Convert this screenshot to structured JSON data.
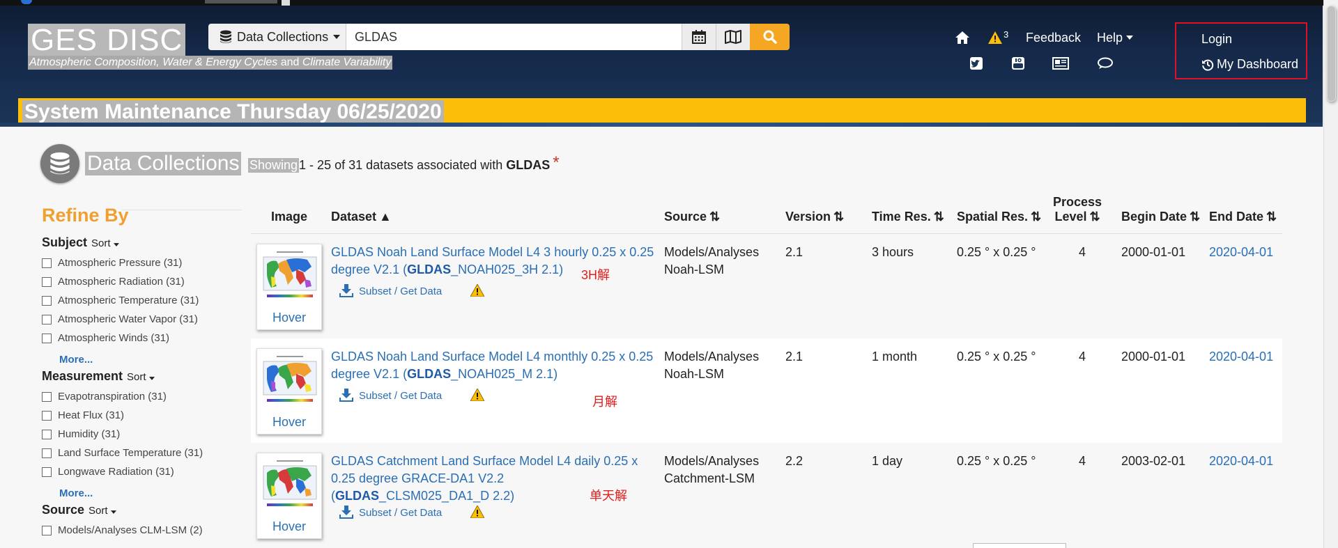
{
  "header": {
    "logo": "GES DISC",
    "tagline": {
      "part1": "Atmospheric Composition, Water & Energy Cycles ",
      "and": " and ",
      "part2": "Climate Variability"
    },
    "search": {
      "collections_label": "Data Collections",
      "query": "GLDAS"
    },
    "nav": {
      "alerts_count": "3",
      "feedback": "Feedback",
      "help": "Help"
    },
    "login": "Login",
    "dashboard": "My Dashboard"
  },
  "banner": {
    "text": "System Maintenance Thursday 06/25/2020"
  },
  "page": {
    "title": "Data Collections",
    "showing_hl": "Showing",
    "showing_rest": " 1 - 25 of 31 datasets associated with",
    "keyword": "GLDAS",
    "star": "*"
  },
  "sidebar": {
    "title": "Refine By",
    "sort_label": "Sort",
    "more_label": "More...",
    "subject": {
      "title": "Subject",
      "options": [
        "Atmospheric Pressure (31)",
        "Atmospheric Radiation (31)",
        "Atmospheric Temperature (31)",
        "Atmospheric Water Vapor (31)",
        "Atmospheric Winds (31)"
      ]
    },
    "measurement": {
      "title": "Measurement",
      "options": [
        "Evapotranspiration (31)",
        "Heat Flux (31)",
        "Humidity (31)",
        "Land Surface Temperature (31)",
        "Longwave Radiation (31)"
      ]
    },
    "source": {
      "title": "Source",
      "options": [
        "Models/Analyses CLM-LSM (2)"
      ]
    }
  },
  "table": {
    "headers": {
      "image": "Image",
      "dataset": "Dataset",
      "source": "Source",
      "version": "Version",
      "time_res": "Time Res.",
      "spatial_res": "Spatial Res.",
      "process_level_1": "Process",
      "process_level_2": "Level",
      "begin_date": "Begin Date",
      "end_date": "End Date"
    },
    "hover_label": "Hover",
    "subset_label": "Subset / Get Data",
    "rows": [
      {
        "title_pre": "GLDAS Noah Land Surface Model L4 3 hourly 0.25 x 0.25 degree V2.1 (",
        "title_bold": "GLDAS",
        "title_post": "_NOAH025_3H 2.1)",
        "note": "3H解",
        "source_1": "Models/Analyses",
        "source_2": "Noah-LSM",
        "version": "2.1",
        "time_res": "3 hours",
        "spatial_res": "0.25 ° x 0.25 °",
        "level": "4",
        "begin": "2000-01-01",
        "end": "2020-04-01"
      },
      {
        "title_pre": "GLDAS Noah Land Surface Model L4 monthly 0.25 x 0.25 degree V2.1 (",
        "title_bold": "GLDAS",
        "title_post": "_NOAH025_M 2.1)",
        "note": "月解",
        "source_1": "Models/Analyses",
        "source_2": "Noah-LSM",
        "version": "2.1",
        "time_res": "1 month",
        "spatial_res": "0.25 ° x 0.25 °",
        "level": "4",
        "begin": "2000-01-01",
        "end": "2020-04-01"
      },
      {
        "title_pre": "GLDAS Catchment Land Surface Model L4 daily 0.25 x 0.25 degree GRACE-DA1 V2.2 (",
        "title_bold": "GLDAS",
        "title_post": "_CLSM025_DA1_D 2.2)",
        "note": "单天解",
        "source_1": "Models/Analyses",
        "source_2": "Catchment-LSM",
        "version": "2.2",
        "time_res": "1 day",
        "spatial_res": "0.25 ° x 0.25 °",
        "level": "4",
        "begin": "2003-02-01",
        "end": "2020-04-01"
      }
    ]
  }
}
